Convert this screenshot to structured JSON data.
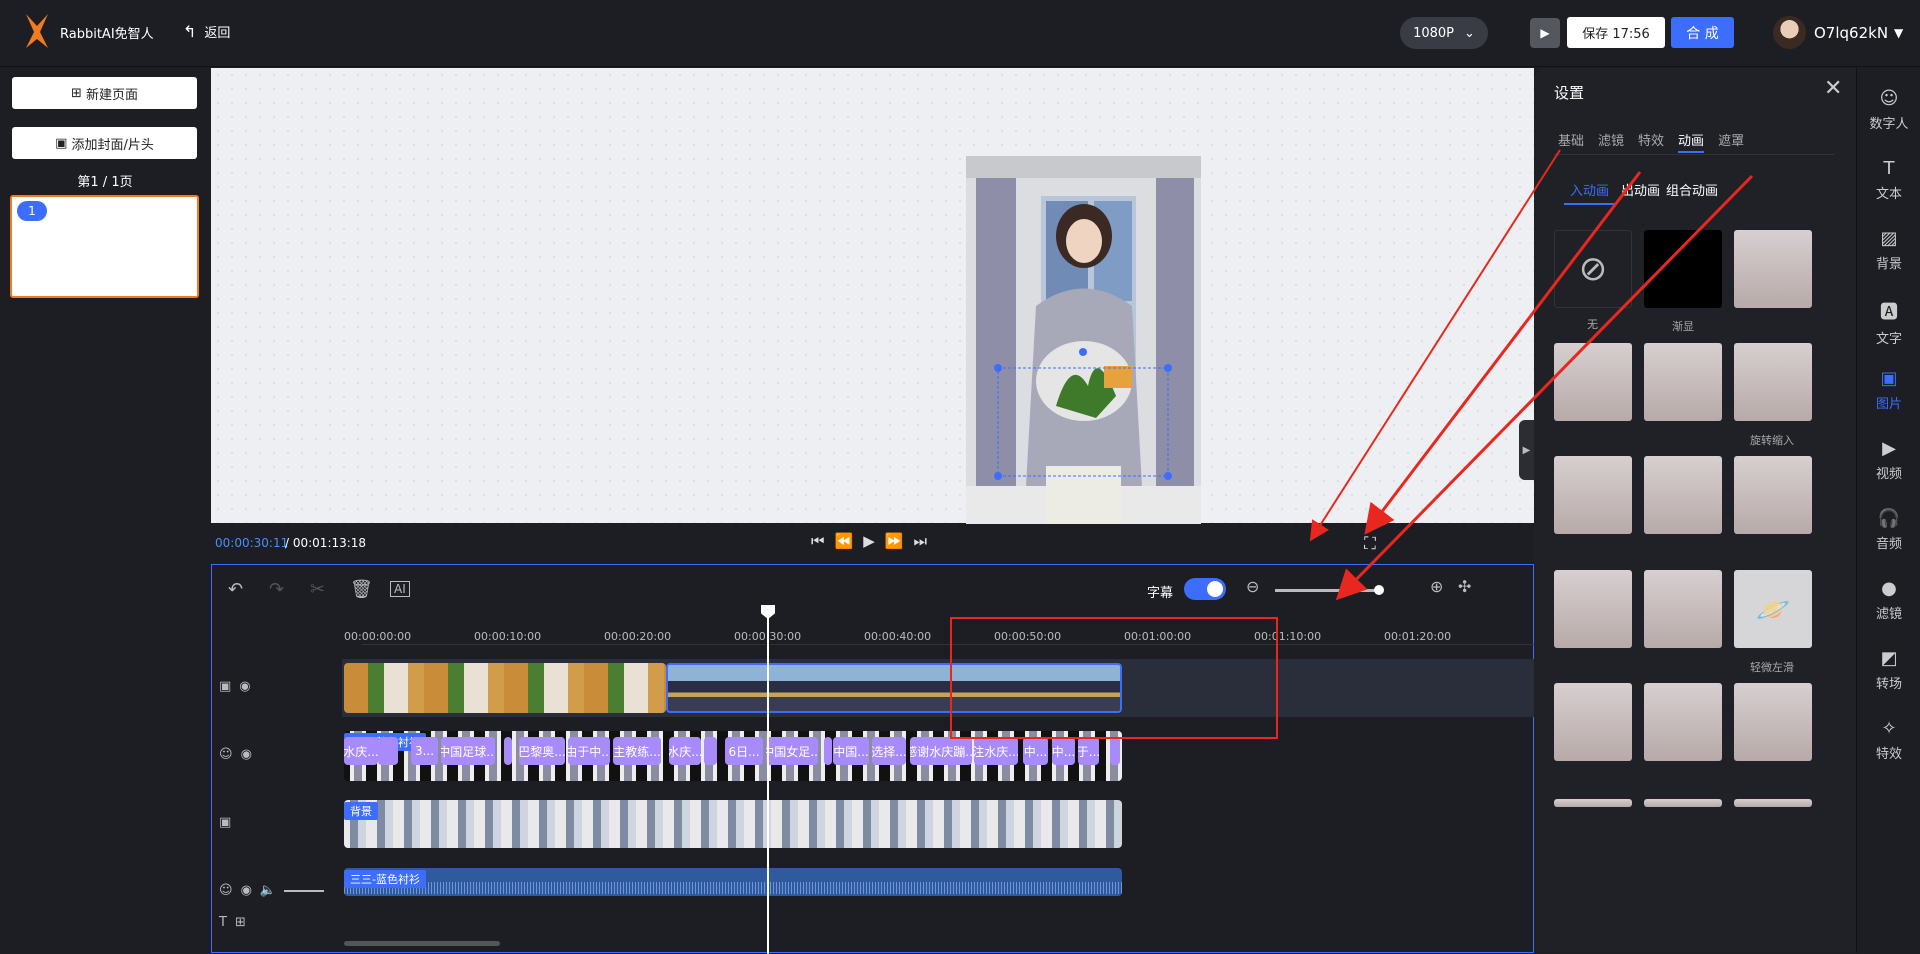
{
  "brand": {
    "name": "RabbitAI免智人"
  },
  "header": {
    "back_label": "返回",
    "resolution": "1080P",
    "save_label": "保存 17:56",
    "compose_label": "合 成",
    "username": "O7lq62kN"
  },
  "left": {
    "new_page": "新建页面",
    "add_cover": "添加封面/片头",
    "page_info": "第1 / 1页",
    "page_badge": "1"
  },
  "player": {
    "current_time": "00:00:30:11",
    "total_time": "/ 00:01:13:18"
  },
  "timeline": {
    "subtitle_label": "字幕",
    "ruler_ticks": [
      "00:00:00:00",
      "00:00:10:00",
      "00:00:20:00",
      "00:00:30:00",
      "00:00:40:00",
      "00:00:50:00",
      "00:01:00:00",
      "00:01:10:00",
      "00:01:20:00"
    ],
    "track_labels": {
      "avatar": "三三-蓝色衬衫",
      "background": "背景",
      "audio": "三三-蓝色衬衫"
    },
    "subtitle_chips": [
      "水庆...",
      "",
      "3...",
      "中国足球...",
      "",
      "巴黎奥...",
      "由于中...",
      "主教练...",
      "水庆...",
      "",
      "6日...",
      "中国女足...",
      "",
      "中国...",
      "选择...",
      "感谢水庆蹦...",
      "注水庆...",
      "中...",
      "中...",
      "于...",
      ""
    ]
  },
  "settings": {
    "title": "设置",
    "tabs": [
      "基础",
      "滤镜",
      "特效",
      "动画",
      "遮罩"
    ],
    "active_tab": "动画",
    "subtabs": [
      "入动画",
      "出动画",
      "组合动画"
    ],
    "active_subtab": "入动画",
    "labels": {
      "none": "无",
      "fade": "渐显",
      "rotate": "旋转缩入",
      "slight_left": "轻微左滑"
    }
  },
  "rightbar": {
    "items": [
      "数字人",
      "文本",
      "背景",
      "文字",
      "图片",
      "视频",
      "音频",
      "滤镜",
      "转场",
      "特效"
    ],
    "active": "图片"
  },
  "colors": {
    "accent": "#3d6dfc",
    "highlight": "#f07b22",
    "annotation": "#e8281f",
    "chip": "#a78bfa"
  }
}
